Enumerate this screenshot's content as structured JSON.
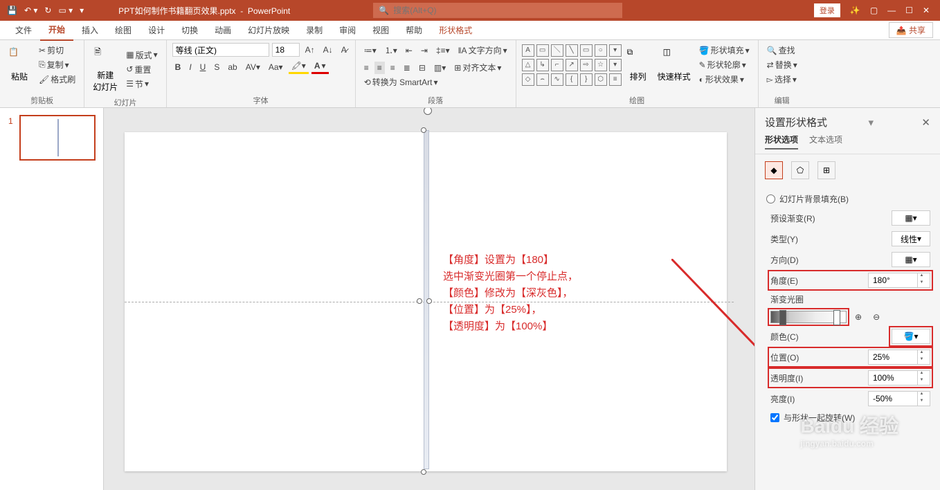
{
  "app": {
    "filename": "PPT如何制作书籍翻页效果.pptx",
    "appname": "PowerPoint",
    "search_placeholder": "搜索(Alt+Q)",
    "login": "登录"
  },
  "menu": {
    "file": "文件",
    "home": "开始",
    "insert": "插入",
    "draw": "绘图",
    "design": "设计",
    "transition": "切换",
    "animation": "动画",
    "slideshow": "幻灯片放映",
    "record": "录制",
    "review": "审阅",
    "view": "视图",
    "help": "帮助",
    "shape_format": "形状格式",
    "share": "共享"
  },
  "ribbon": {
    "clipboard": {
      "label": "剪贴板",
      "cut": "剪切",
      "copy": "复制",
      "format_painter": "格式刷",
      "paste": "粘贴"
    },
    "slides": {
      "label": "幻灯片",
      "new_slide": "新建\n幻灯片",
      "layout": "版式",
      "reset": "重置",
      "section": "节"
    },
    "font": {
      "label": "字体",
      "name": "等线 (正文)",
      "size": "18"
    },
    "paragraph": {
      "label": "段落",
      "text_direction": "文字方向",
      "align_text": "对齐文本",
      "smartart": "转换为 SmartArt"
    },
    "drawing": {
      "label": "绘图",
      "arrange": "排列",
      "quick_styles": "快速样式",
      "shape_fill": "形状填充",
      "shape_outline": "形状轮廓",
      "shape_effects": "形状效果"
    },
    "editing": {
      "label": "编辑",
      "find": "查找",
      "replace": "替换",
      "select": "选择"
    }
  },
  "slide_nav": {
    "num": "1"
  },
  "annotation": {
    "l1": "【角度】设置为【180】",
    "l2": "选中渐变光圈第一个停止点，",
    "l3": "【颜色】修改为【深灰色】，",
    "l4": "【位置】为【25%】，",
    "l5": "【透明度】为【100%】"
  },
  "pane": {
    "title": "设置形状格式",
    "tabs": {
      "shape": "形状选项",
      "text": "文本选项"
    },
    "fill": {
      "bg": "幻灯片背景填充(B)",
      "preset": "预设渐变(R)",
      "type_label": "类型(Y)",
      "type_value": "线性",
      "direction": "方向(D)",
      "angle_label": "角度(E)",
      "angle_value": "180°",
      "stops_label": "渐变光圈",
      "color": "颜色(C)",
      "position_label": "位置(O)",
      "position_value": "25%",
      "transparency_label": "透明度(I)",
      "transparency_value": "100%",
      "brightness_label": "亮度(I)",
      "brightness_value": "-50%",
      "rotate_with_shape": "与形状一起旋转(W)"
    }
  },
  "watermark": {
    "brand": "Baidu 经验",
    "url": "jingyan.baidu.com"
  }
}
